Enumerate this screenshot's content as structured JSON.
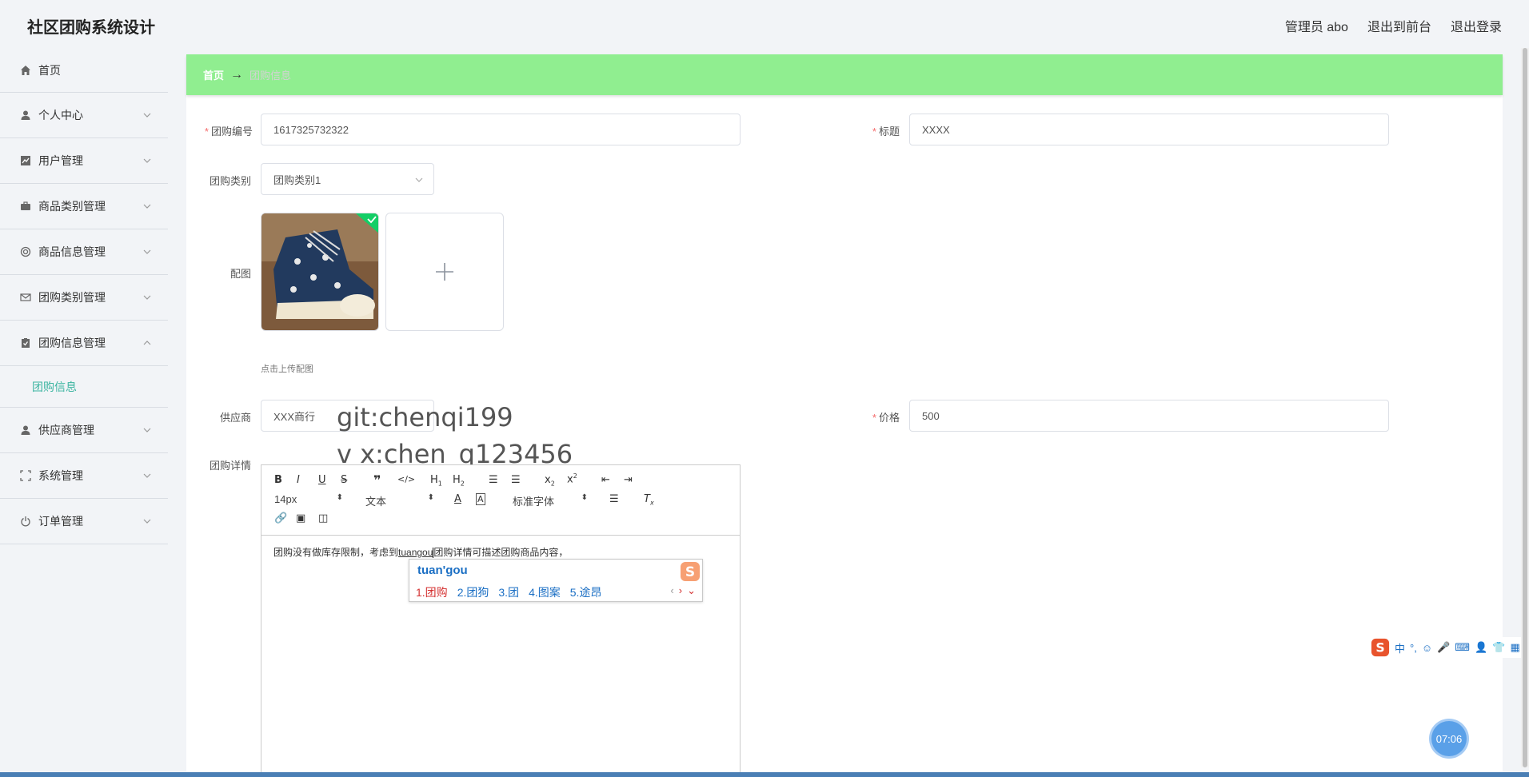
{
  "header": {
    "app_title": "社区团购系统设计",
    "user_label": "管理员 abo",
    "front_link": "退出到前台",
    "logout_link": "退出登录"
  },
  "sidebar": {
    "items": [
      {
        "label": "首页",
        "icon": "home-icon"
      },
      {
        "label": "个人中心",
        "icon": "user-icon"
      },
      {
        "label": "用户管理",
        "icon": "chart-icon"
      },
      {
        "label": "商品类别管理",
        "icon": "briefcase-icon"
      },
      {
        "label": "商品信息管理",
        "icon": "lifebuoy-icon"
      },
      {
        "label": "团购类别管理",
        "icon": "mail-icon"
      },
      {
        "label": "团购信息管理",
        "icon": "clipboard-icon"
      },
      {
        "label": "供应商管理",
        "icon": "user-icon"
      },
      {
        "label": "系统管理",
        "icon": "fullscreen-icon"
      },
      {
        "label": "订单管理",
        "icon": "power-icon"
      }
    ],
    "sub_active": "团购信息"
  },
  "breadcrumb": {
    "home": "首页",
    "arrow": "→",
    "current": "团购信息"
  },
  "form": {
    "code_label": "团购编号",
    "code_value": "1617325732322",
    "title_label": "标题",
    "title_value": "XXXX",
    "category_label": "团购类别",
    "category_value": "团购类别1",
    "image_label": "配图",
    "upload_hint": "点击上传配图",
    "supplier_label": "供应商",
    "supplier_value": "XXX商行",
    "price_label": "价格",
    "price_value": "500",
    "detail_label": "团购详情"
  },
  "watermark": {
    "line1": "git:chenqi199",
    "line2": "v x:chen_q123456"
  },
  "editor": {
    "font_size": "14px",
    "block_type": "文本",
    "font_family": "标准字体",
    "content_before": "团购没有做库存限制，考虑到",
    "content_composing": "tuangou",
    "content_after": "团购详情可描述团购商品内容，"
  },
  "ime": {
    "input": "tuan'gou",
    "candidates": [
      "1.团购",
      "2.团狗",
      "3.团",
      "4.图案",
      "5.途昂"
    ],
    "status_items": [
      "中",
      "°,",
      "☺",
      "🎤",
      "⌨",
      "👤",
      "👕",
      "▦"
    ]
  },
  "timer": "07:06",
  "colors": {
    "breadcrumb_bg": "#90ee90",
    "active_sub": "#3bb4a0",
    "required": "#f56c6c"
  }
}
